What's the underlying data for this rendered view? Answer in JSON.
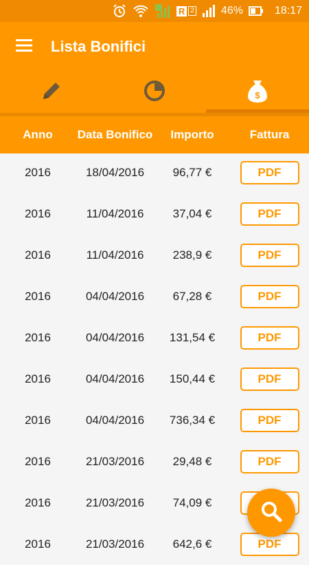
{
  "status": {
    "battery_percent": "46%",
    "time": "18:17",
    "sim_badge": "R",
    "sim_slot": "2"
  },
  "toolbar": {
    "title": "Lista Bonifici"
  },
  "tabs": [
    {
      "icon": "pencil-icon"
    },
    {
      "icon": "pie-chart-icon"
    },
    {
      "icon": "money-bag-icon"
    }
  ],
  "table": {
    "headers": [
      "Anno",
      "Data Bonifico",
      "Importo",
      "Fattura"
    ],
    "rows": [
      {
        "anno": "2016",
        "data": "18/04/2016",
        "importo": "96,77 €",
        "fattura": "PDF"
      },
      {
        "anno": "2016",
        "data": "11/04/2016",
        "importo": "37,04 €",
        "fattura": "PDF"
      },
      {
        "anno": "2016",
        "data": "11/04/2016",
        "importo": "238,9 €",
        "fattura": "PDF"
      },
      {
        "anno": "2016",
        "data": "04/04/2016",
        "importo": "67,28 €",
        "fattura": "PDF"
      },
      {
        "anno": "2016",
        "data": "04/04/2016",
        "importo": "131,54 €",
        "fattura": "PDF"
      },
      {
        "anno": "2016",
        "data": "04/04/2016",
        "importo": "150,44 €",
        "fattura": "PDF"
      },
      {
        "anno": "2016",
        "data": "04/04/2016",
        "importo": "736,34 €",
        "fattura": "PDF"
      },
      {
        "anno": "2016",
        "data": "21/03/2016",
        "importo": "29,48 €",
        "fattura": "PDF"
      },
      {
        "anno": "2016",
        "data": "21/03/2016",
        "importo": "74,09 €",
        "fattura": "PDF"
      },
      {
        "anno": "2016",
        "data": "21/03/2016",
        "importo": "642,6 €",
        "fattura": "PDF"
      }
    ]
  },
  "colors": {
    "primary": "#ff9800",
    "status_bar": "#f08a00",
    "accent_dark": "#e07b00"
  }
}
